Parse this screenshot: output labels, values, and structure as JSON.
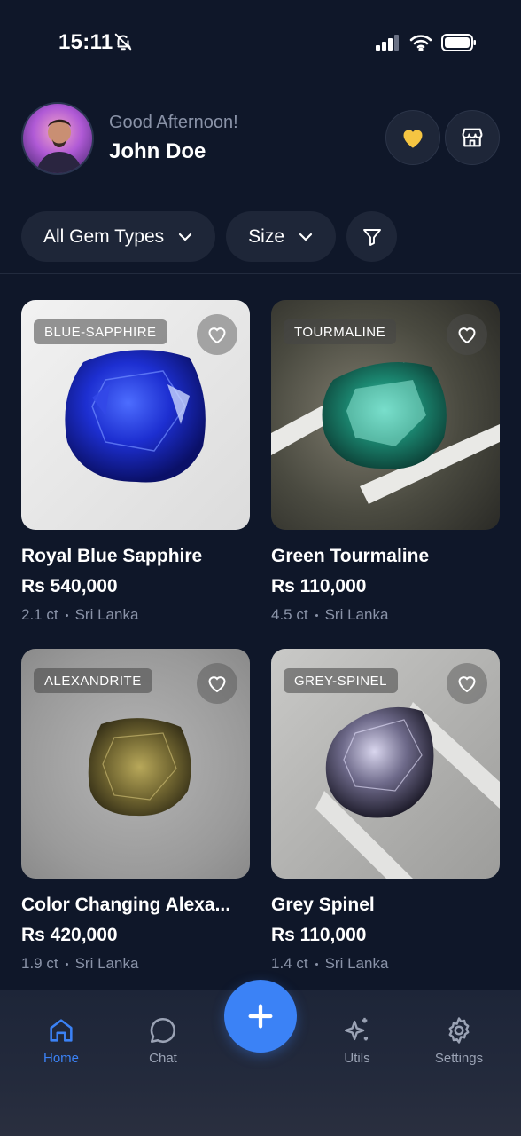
{
  "status_bar": {
    "time": "15:11"
  },
  "header": {
    "greeting": "Good Afternoon!",
    "user_name": "John Doe"
  },
  "filters": {
    "gem_types_label": "All Gem Types",
    "size_label": "Size"
  },
  "products": [
    {
      "tag": "BLUE-SAPPHIRE",
      "name": "Royal Blue Sapphire",
      "price": "Rs 540,000",
      "carat": "2.1 ct",
      "origin": "Sri Lanka"
    },
    {
      "tag": "TOURMALINE",
      "name": "Green Tourmaline",
      "price": "Rs 110,000",
      "carat": "4.5 ct",
      "origin": "Sri Lanka"
    },
    {
      "tag": "ALEXANDRITE",
      "name": "Color Changing Alexa...",
      "price": "Rs 420,000",
      "carat": "1.9 ct",
      "origin": "Sri Lanka"
    },
    {
      "tag": "GREY-SPINEL",
      "name": "Grey Spinel",
      "price": "Rs 110,000",
      "carat": "1.4 ct",
      "origin": "Sri Lanka"
    }
  ],
  "nav": {
    "home": "Home",
    "chat": "Chat",
    "utils": "Utils",
    "settings": "Settings"
  },
  "colors": {
    "background": "#0f1729",
    "surface": "#1e2638",
    "accent": "#3b82f6",
    "favorite": "#f5c542",
    "muted_text": "#8a93a8"
  }
}
